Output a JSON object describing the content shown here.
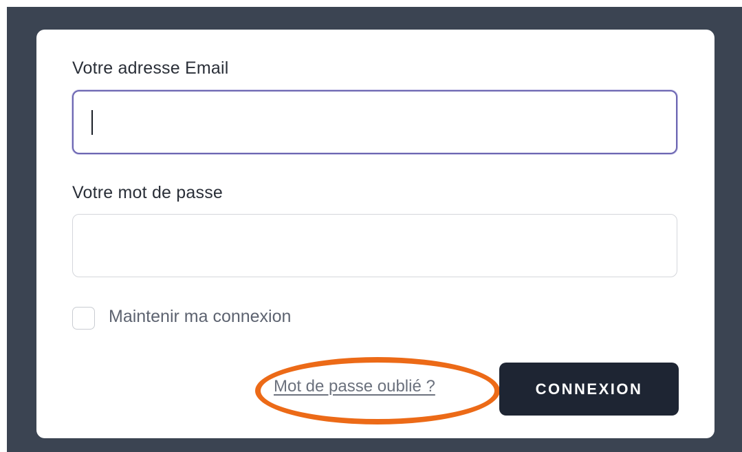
{
  "login_form": {
    "email_label": "Votre adresse Email",
    "email_value": "",
    "password_label": "Votre mot de passe",
    "password_value": "",
    "remember_label": "Maintenir ma connexion",
    "remember_checked": false,
    "forgot_link": "Mot de passe oublié ?",
    "submit_label": "CONNEXION"
  },
  "annotation": {
    "highlight_color": "#ec6a17",
    "highlight_shape": "ellipse",
    "highlight_target": "forgot-password-link"
  },
  "colors": {
    "backdrop": "#3b4452",
    "card": "#ffffff",
    "button": "#1e2533",
    "focus_border": "#6d67b2"
  }
}
